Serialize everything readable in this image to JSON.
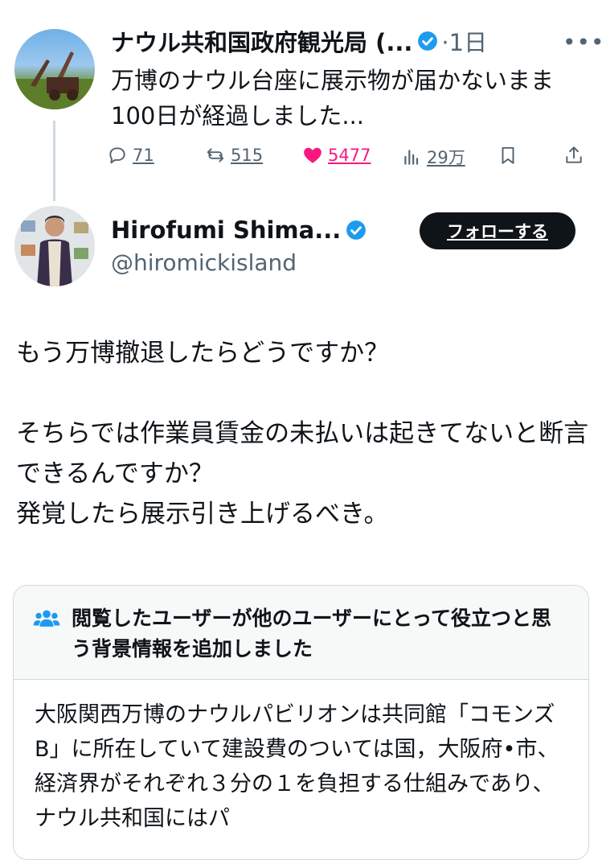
{
  "post1": {
    "author_name": "ナウル共和国政府観光局 (...",
    "time": "·1日",
    "text": "万博のナウル台座に展示物が届かないまま100日が経過しました...",
    "actions": {
      "replies": "71",
      "reposts": "515",
      "likes": "5477",
      "views": "29万"
    }
  },
  "post2": {
    "author_name": "Hirofumi Shima...",
    "handle": "@hiromickisland",
    "follow_label": "フォローする",
    "text": "もう万博撤退したらどうですか？\n\nそちらでは作業員賃金の未払いは起きてないと断言できるんですか？\n発覚したら展示引き上げるべき。"
  },
  "community_note": {
    "header": "閲覧したユーザーが他のユーザーにとって役立つと思う背景情報を追加しました",
    "body": "大阪関西万博のナウルパビリオンは共同館「コモンズB」に所在していて建設費のついては国，大阪府•市、経済界がそれぞれ３分の１を負担する仕組みであり、ナウル共和国にはパ"
  },
  "colors": {
    "like": "#f91880",
    "verified": "#1d9bf0",
    "muted": "#536471"
  }
}
